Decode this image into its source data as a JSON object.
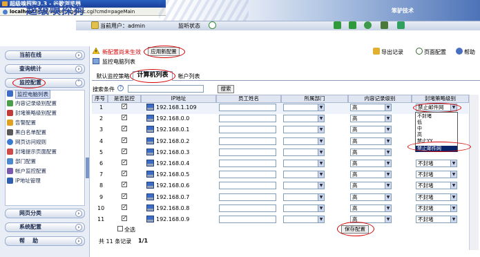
{
  "window": {
    "title": "超级嗅探狗3.3 - 谷歌浏览器"
  },
  "address": {
    "host": "localhost",
    "path": ":9090/cgi-bin/cgiproc.cgi?cmd=pageMain"
  },
  "header": {
    "logo": "超级嗅探狗",
    "brand": "笨驴技术",
    "user": "当前用户：admin",
    "status": "监听状态"
  },
  "sidebar": {
    "sections": [
      {
        "label": "当前在线"
      },
      {
        "label": "查询统计"
      },
      {
        "label": "监控配置"
      }
    ],
    "items": [
      {
        "label": "监控电脑列表",
        "icon": "computer-icon",
        "color": "#3d6cc7"
      },
      {
        "label": "内容记录级别配置",
        "icon": "list-icon",
        "color": "#4a9e4a"
      },
      {
        "label": "封堵策略级别配置",
        "icon": "shield-icon",
        "color": "#c23b3b"
      },
      {
        "label": "告警配置",
        "icon": "bell-icon",
        "color": "#e0a020"
      },
      {
        "label": "黑白名单配置",
        "icon": "contacts-icon",
        "color": "#5a5a5a"
      },
      {
        "label": "网页访问规则",
        "icon": "globe-icon",
        "color": "#3a7ad0"
      },
      {
        "label": "封堵提示页面配置",
        "icon": "page-icon",
        "color": "#d04a4a"
      },
      {
        "label": "部门配置",
        "icon": "group-icon",
        "color": "#4a8acc"
      },
      {
        "label": "帐户监控配置",
        "icon": "user-icon",
        "color": "#7a5ab0"
      },
      {
        "label": "IP地址管理",
        "icon": "wrench-icon",
        "color": "#2f5fb0"
      }
    ],
    "bottom_sections": [
      {
        "label": "网页分类"
      },
      {
        "label": "系统配置"
      },
      {
        "label": "帮    助"
      }
    ]
  },
  "notice": {
    "warning": "新配置尚未生效",
    "apply_button": "应用新配置",
    "subtitle": "监控电脑列表"
  },
  "actions": {
    "export": "导出记录",
    "page_config": "页面配置",
    "help": "帮助"
  },
  "tabs": [
    {
      "label": "默认监控策略"
    },
    {
      "label": "计算机列表"
    },
    {
      "label": "帐户列表"
    }
  ],
  "search": {
    "label": "搜索条件",
    "help": "?",
    "button": "搜索"
  },
  "table": {
    "headers": [
      "序号",
      "是否监控",
      "IP地址",
      "员工姓名",
      "所属部门",
      "内容记录级别",
      "封堵策略级别"
    ],
    "rows": [
      {
        "num": "1",
        "monitored": true,
        "ip": "192.168.1.109",
        "name": "",
        "dept": "",
        "record": "高",
        "block": "禁止邮件网"
      },
      {
        "num": "2",
        "monitored": true,
        "ip": "192.168.0.0",
        "name": "",
        "dept": "",
        "record": "高",
        "block": ""
      },
      {
        "num": "3",
        "monitored": true,
        "ip": "192.168.0.1",
        "name": "",
        "dept": "",
        "record": "高",
        "block": ""
      },
      {
        "num": "4",
        "monitored": true,
        "ip": "192.168.0.2",
        "name": "",
        "dept": "",
        "record": "高",
        "block": ""
      },
      {
        "num": "5",
        "monitored": true,
        "ip": "192.168.0.3",
        "name": "",
        "dept": "",
        "record": "高",
        "block": ""
      },
      {
        "num": "6",
        "monitored": true,
        "ip": "192.168.0.4",
        "name": "",
        "dept": "",
        "record": "高",
        "block": "不封堵"
      },
      {
        "num": "7",
        "monitored": true,
        "ip": "192.168.0.5",
        "name": "",
        "dept": "",
        "record": "高",
        "block": "不封堵"
      },
      {
        "num": "8",
        "monitored": true,
        "ip": "192.168.0.6",
        "name": "",
        "dept": "",
        "record": "高",
        "block": "不封堵"
      },
      {
        "num": "9",
        "monitored": true,
        "ip": "192.168.0.7",
        "name": "",
        "dept": "",
        "record": "高",
        "block": "不封堵"
      },
      {
        "num": "10",
        "monitored": true,
        "ip": "192.168.0.8",
        "name": "",
        "dept": "",
        "record": "高",
        "block": "不封堵"
      },
      {
        "num": "11",
        "monitored": true,
        "ip": "192.168.0.9",
        "name": "",
        "dept": "",
        "record": "高",
        "block": "不封堵"
      }
    ]
  },
  "dropdown": {
    "options": [
      "不封堵",
      "低",
      "中",
      "高",
      "禁止YY",
      "禁止邮件网"
    ],
    "selected": "禁止邮件网"
  },
  "footer": {
    "select_all": "全选",
    "save_button": "保存配置",
    "total": "共 11 条记录",
    "page": "1/1"
  }
}
